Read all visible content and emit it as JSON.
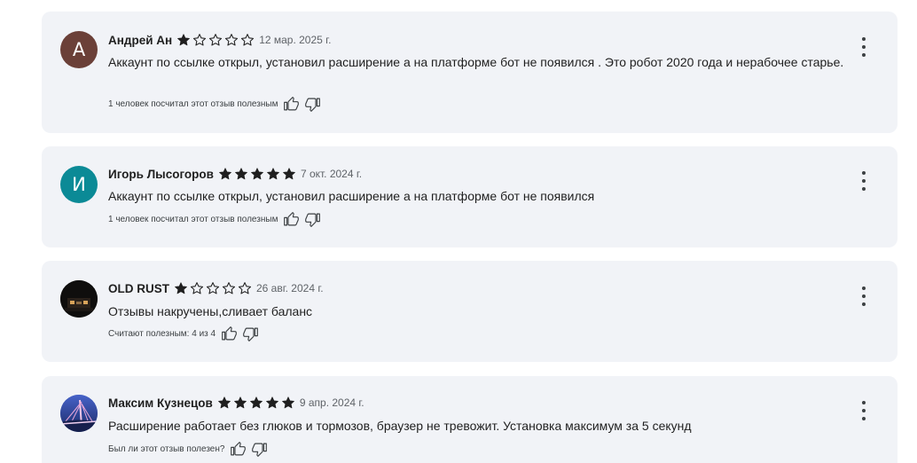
{
  "colors": {
    "card_bg": "#f1f3f7",
    "star": "#1f1f1f",
    "avatar_andrey": "#6b4038",
    "avatar_igor": "#0b8a96"
  },
  "reviews": [
    {
      "author": "Андрей Ан",
      "avatar_letter": "А",
      "rating": 1,
      "date": "12 мар. 2025 г.",
      "text": "Аккаунт по ссылке открыл, установил расширение а на платформе бот не появился . Это робот 2020 года и нерабочее старье.",
      "helpful": "1 человек посчитал этот отзыв полезным"
    },
    {
      "author": "Игорь Лысогоров",
      "avatar_letter": "И",
      "rating": 5,
      "date": "7 окт. 2024 г.",
      "text": "Аккаунт по ссылке открыл, установил расширение а на платформе бот не появился",
      "helpful": "1 человек посчитал этот отзыв полезным"
    },
    {
      "author": "OLD RUST",
      "avatar_letter": "",
      "rating": 1,
      "date": "26 авг. 2024 г.",
      "text": "Отзывы накручены,сливает баланс",
      "helpful": "Считают полезным: 4 из 4"
    },
    {
      "author": "Максим Кузнецов",
      "avatar_letter": "",
      "rating": 5,
      "date": "9 апр. 2024 г.",
      "text": "Расширение работает без глюков и тормозов, браузер не тревожит. Установка максимум за 5 секунд",
      "helpful": "Был ли этот отзыв полезен?"
    }
  ],
  "icons": {
    "star_filled": "star-filled-icon",
    "star_empty": "star-outline-icon",
    "thumb_up": "thumb-up-icon",
    "thumb_down": "thumb-down-icon",
    "more": "more-vertical-icon"
  }
}
